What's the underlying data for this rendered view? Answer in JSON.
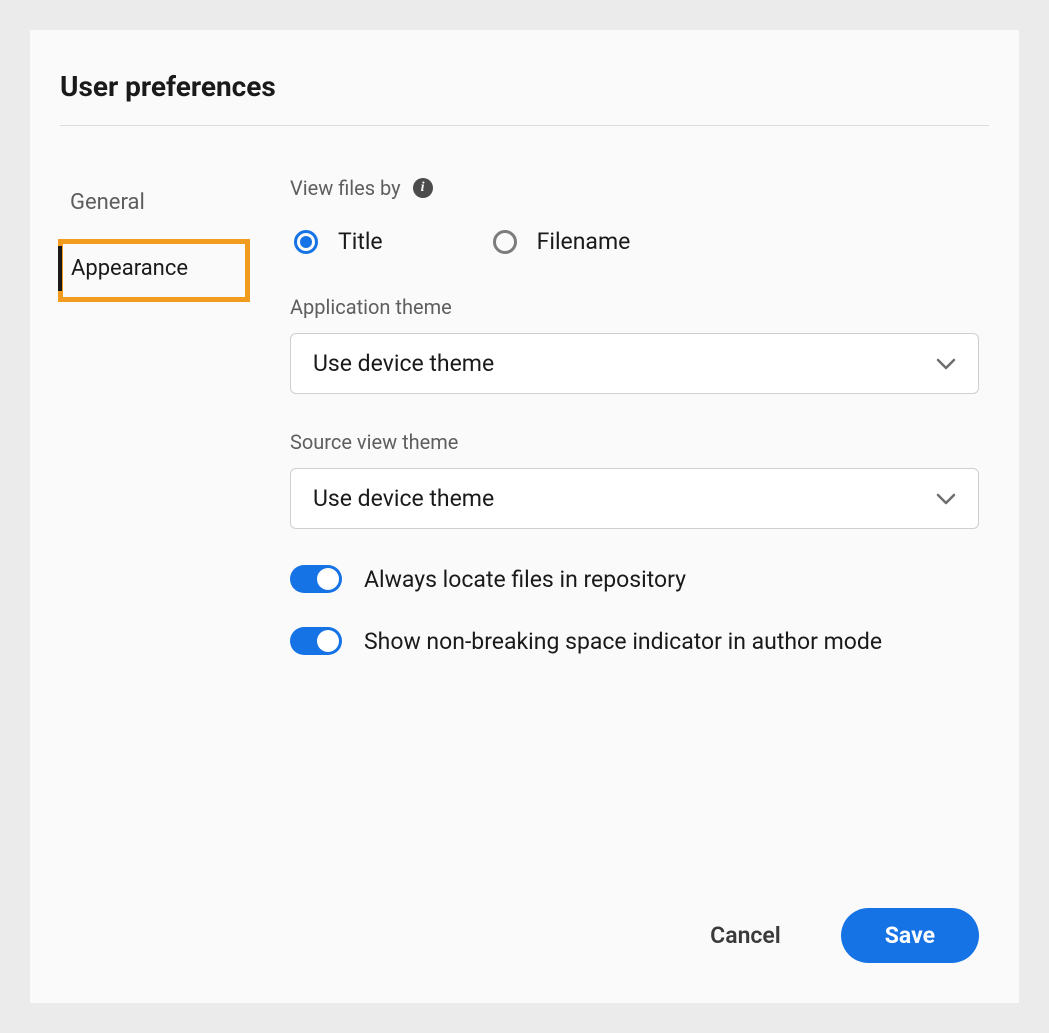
{
  "title": "User preferences",
  "sidebar": {
    "items": [
      {
        "label": "General",
        "active": false
      },
      {
        "label": "Appearance",
        "active": true
      }
    ]
  },
  "main": {
    "view_files_by": {
      "label": "View files by",
      "options": [
        {
          "label": "Title",
          "checked": true
        },
        {
          "label": "Filename",
          "checked": false
        }
      ]
    },
    "application_theme": {
      "label": "Application theme",
      "value": "Use device theme"
    },
    "source_view_theme": {
      "label": "Source view theme",
      "value": "Use device theme"
    },
    "toggles": [
      {
        "label": "Always locate files in repository",
        "on": true
      },
      {
        "label": "Show non-breaking space indicator in author mode",
        "on": true
      }
    ]
  },
  "footer": {
    "cancel": "Cancel",
    "save": "Save"
  }
}
